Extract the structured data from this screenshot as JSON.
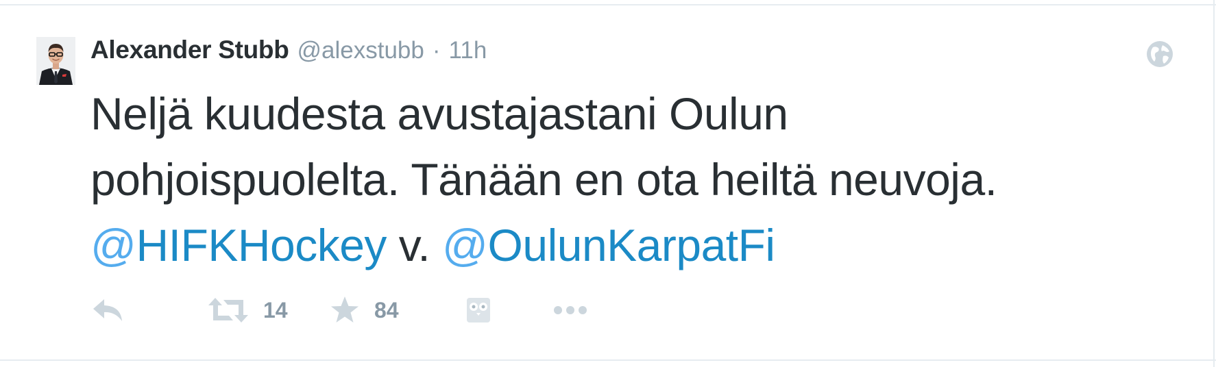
{
  "tweet": {
    "author": {
      "name": "Alexander Stubb",
      "handle": "@alexstubb",
      "separator": "·",
      "time": "11h"
    },
    "text": {
      "line1": "Neljä kuudesta avustajastani Oulun",
      "line2": "pohjoispuolelta. Tänään en ota heiltä neuvoja.",
      "mention1_at": "@",
      "mention1_name": "HIFKHockey",
      "between": " v. ",
      "mention2_at": "@",
      "mention2_name": "OulunKarpatFi"
    },
    "actions": {
      "reply_icon": "reply-icon",
      "retweet_icon": "retweet-icon",
      "retweet_count": "14",
      "favorite_icon": "star-icon",
      "favorite_count": "84",
      "owl_icon": "owl-icon",
      "more_icon": "more-dots-icon"
    },
    "privacy_icon": "globe-icon"
  },
  "colors": {
    "text": "#292f33",
    "muted": "#8899a6",
    "link": "#1b8ac6",
    "icon": "#aab8c2",
    "border": "#e1e8ed"
  }
}
